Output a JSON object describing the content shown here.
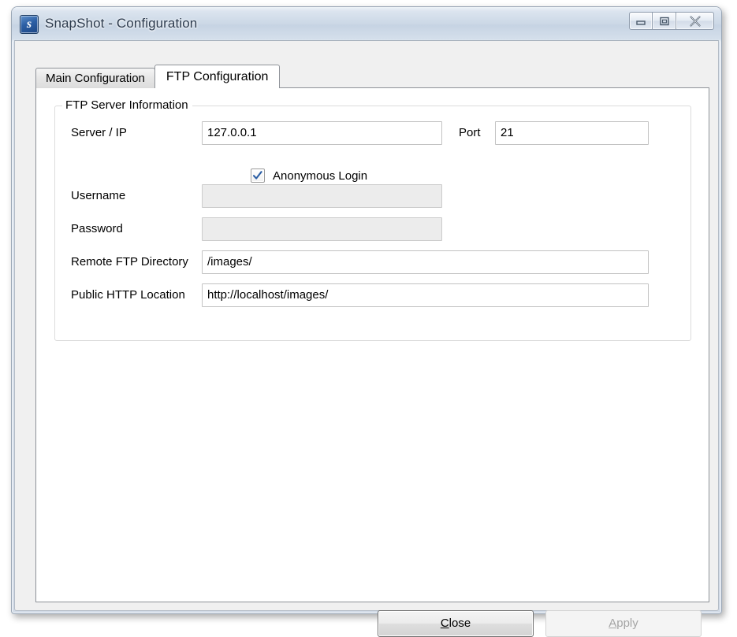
{
  "window": {
    "title": "SnapShot - Configuration",
    "app_icon": "snapshot-app-icon",
    "icon_letter": "s",
    "controls": {
      "minimize": "minimize-icon",
      "maximize": "maximize-icon",
      "close": "close-icon"
    }
  },
  "tabs": [
    {
      "label": "Main Configuration",
      "active": false
    },
    {
      "label": "FTP Configuration",
      "active": true
    }
  ],
  "groupbox": {
    "legend": "FTP Server Information"
  },
  "fields": {
    "server_ip": {
      "label": "Server / IP",
      "value": "127.0.0.1",
      "placeholder": "",
      "disabled": false
    },
    "port": {
      "label": "Port",
      "value": "21",
      "placeholder": "",
      "disabled": false
    },
    "anonymous_login": {
      "label": "Anonymous Login",
      "checked": true,
      "check_glyph": "checkmark-icon"
    },
    "username": {
      "label": "Username",
      "value": "",
      "placeholder": "",
      "disabled": true
    },
    "password": {
      "label": "Password",
      "value": "",
      "placeholder": "",
      "disabled": true
    },
    "remote_ftp_directory": {
      "label": "Remote FTP Directory",
      "value": "/images/",
      "placeholder": "",
      "disabled": false
    },
    "public_http_location": {
      "label": "Public HTTP Location",
      "value": "http://localhost/images/",
      "placeholder": "",
      "disabled": false
    }
  },
  "buttons": {
    "close": {
      "label": "Close",
      "mnemonic": "C",
      "rest": "lose",
      "enabled": true,
      "default": true
    },
    "apply": {
      "label": "Apply",
      "mnemonic": "A",
      "rest": "pply",
      "enabled": false,
      "default": false
    }
  },
  "colors": {
    "titlebar_glass": "#ccd8e6",
    "window_border": "#9aa7b6",
    "client_background": "#f0f0f0",
    "panel_background": "#ffffff",
    "checkmark_blue": "#2c5fa5",
    "disabled_field": "#ececec",
    "disabled_text": "#a5a5a5"
  }
}
